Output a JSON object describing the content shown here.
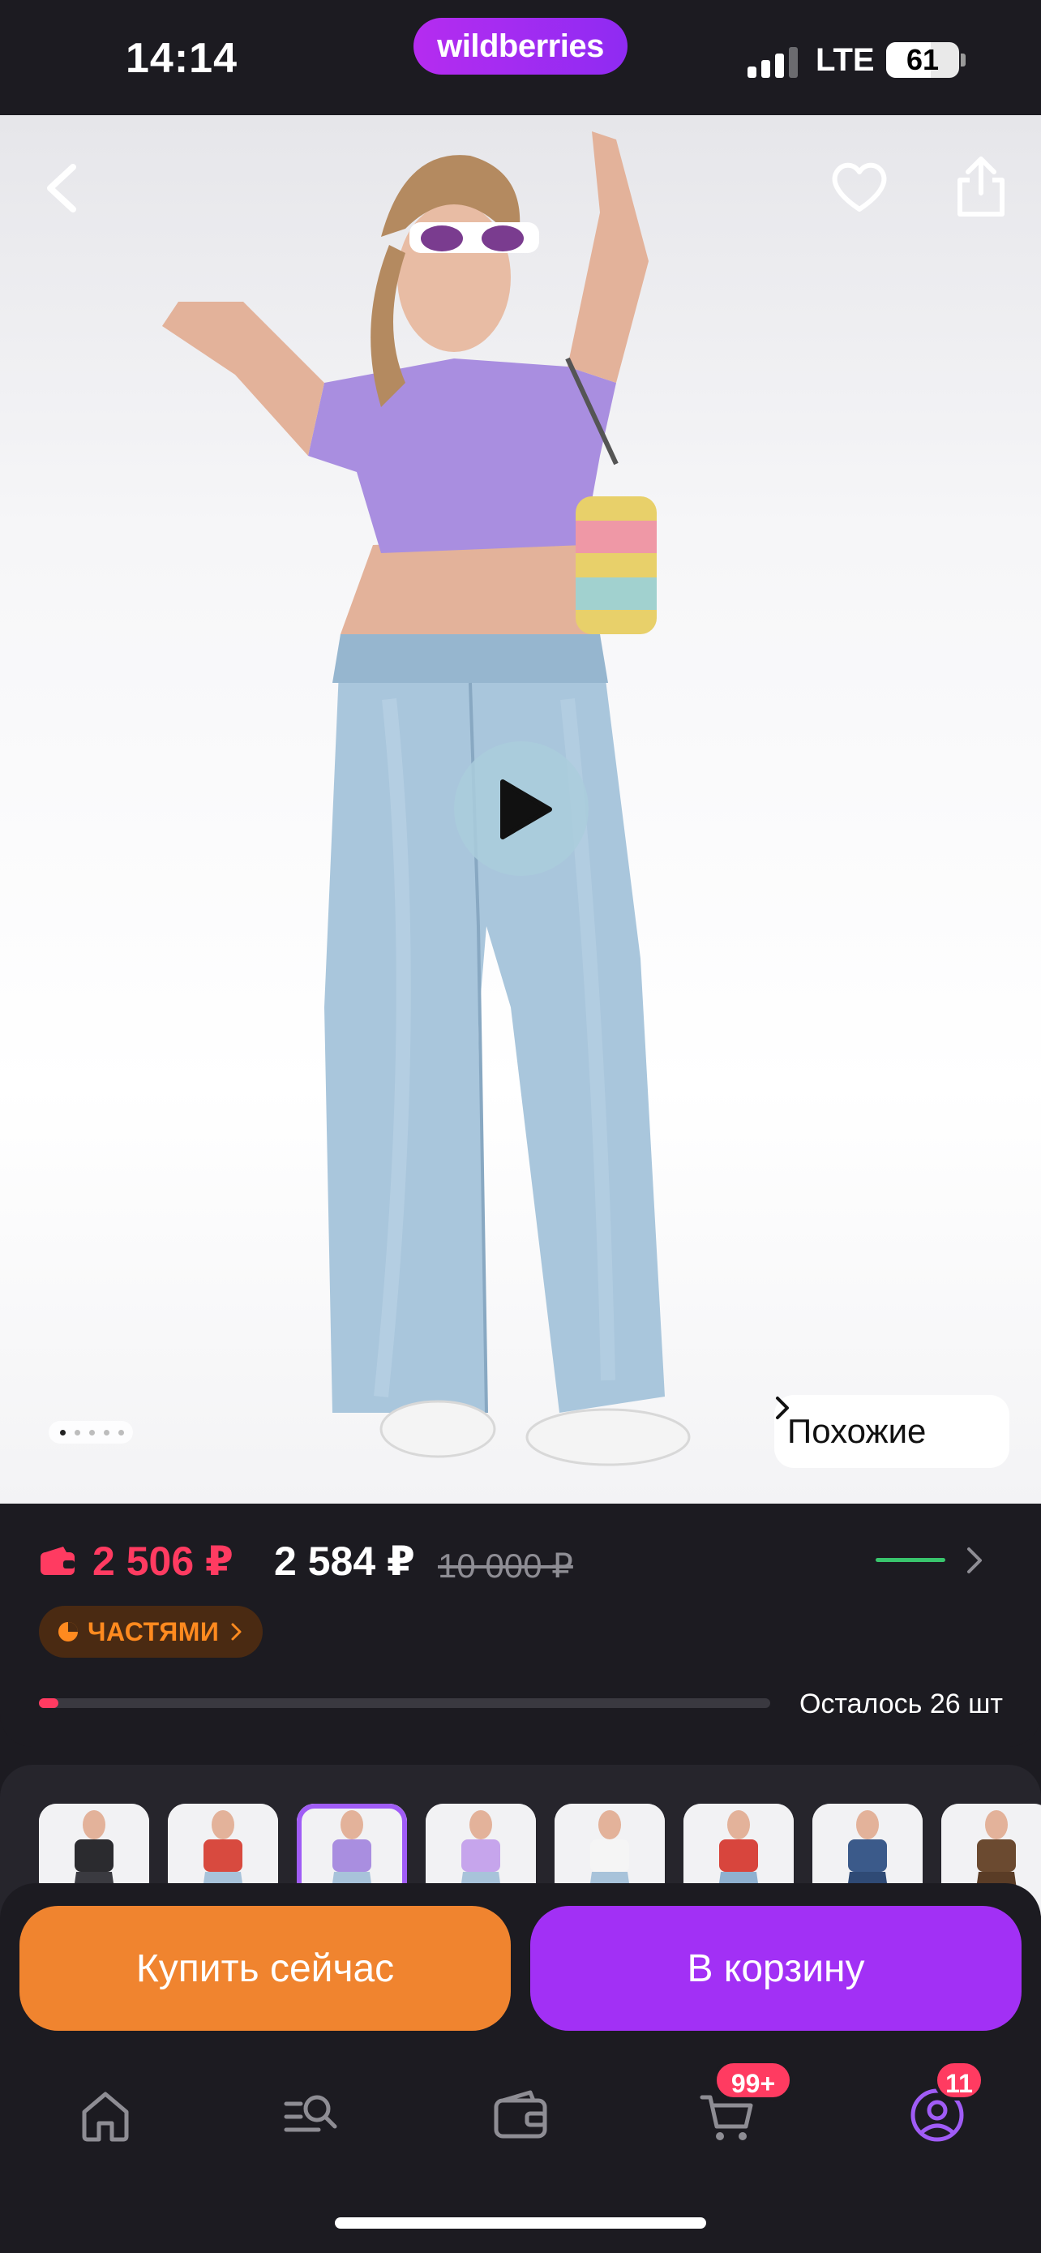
{
  "status_bar": {
    "time": "14:14",
    "brand": "wildberries",
    "network": "LTE",
    "battery": "61",
    "battery_level": 0.61
  },
  "product": {
    "media": {
      "slides_total": 5,
      "current_slide": 1,
      "has_video": true,
      "similar_label": "Похожие"
    },
    "price_wallet": "2 506 ₽",
    "price": "2 584 ₽",
    "price_old": "10 000 ₽",
    "installments_label": "ЧАСТЯМИ",
    "stock_label": "Осталось 26 шт",
    "stock_level": 0.02
  },
  "variants": {
    "selected_index": 2,
    "items": [
      "black-jeans",
      "red-top-light-jeans",
      "purple-top-light-jeans",
      "lilac-top-light-jeans",
      "white-top-light-jeans",
      "red-tshirt-jeans",
      "dark-blue-jeans",
      "brown-pants"
    ]
  },
  "actions": {
    "buy_now": "Купить сейчас",
    "add_to_cart": "В корзину"
  },
  "tabbar": {
    "items": [
      "home",
      "catalog-search",
      "wallet",
      "cart",
      "profile"
    ],
    "cart_badge": "99+",
    "profile_badge": "11"
  },
  "colors": {
    "accent_purple": "#a230f5",
    "accent_orange": "#f0842f",
    "price_red": "#ff3b61",
    "background": "#1c1b21"
  }
}
